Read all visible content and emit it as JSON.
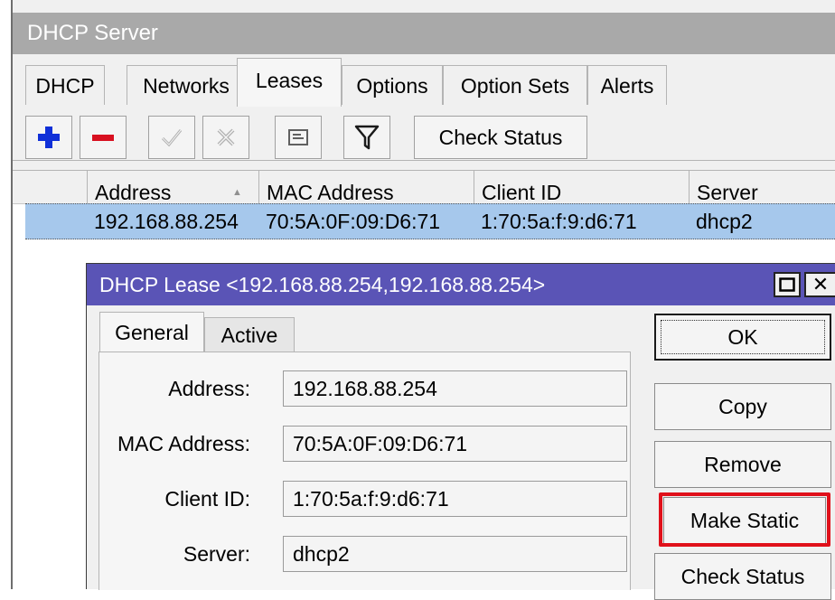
{
  "window": {
    "title": "DHCP Server"
  },
  "tabs": [
    "DHCP",
    "Networks",
    "Leases",
    "Options",
    "Option Sets",
    "Alerts"
  ],
  "active_tab": "Leases",
  "toolbar": {
    "icons": [
      "plus-icon",
      "minus-icon",
      "check-icon",
      "cross-icon",
      "note-icon",
      "filter-icon"
    ],
    "check_status_label": "Check Status"
  },
  "table": {
    "columns": [
      "Address",
      "MAC Address",
      "Client ID",
      "Server"
    ],
    "sort_indicator": "▲",
    "rows": [
      [
        "192.168.88.254",
        "70:5A:0F:09:D6:71",
        "1:70:5a:f:9:d6:71",
        "dhcp2"
      ]
    ]
  },
  "dialog": {
    "title": "DHCP Lease <192.168.88.254,192.168.88.254>",
    "tabs": [
      "General",
      "Active"
    ],
    "active_tab": "General",
    "fields": [
      {
        "label": "Address:",
        "value": "192.168.88.254"
      },
      {
        "label": "MAC Address:",
        "value": "70:5A:0F:09:D6:71"
      },
      {
        "label": "Client ID:",
        "value": "1:70:5a:f:9:d6:71"
      },
      {
        "label": "Server:",
        "value": "dhcp2"
      }
    ],
    "buttons": [
      "OK",
      "Copy",
      "Remove",
      "Make Static",
      "Check Status"
    ],
    "highlighted_button": "Make Static"
  },
  "colors": {
    "dialog_title_bg": "#5a54b6",
    "selection_bg": "#a6c8ec",
    "highlight": "#e0101a",
    "add_icon": "#1030d8",
    "remove_icon": "#d81020"
  }
}
